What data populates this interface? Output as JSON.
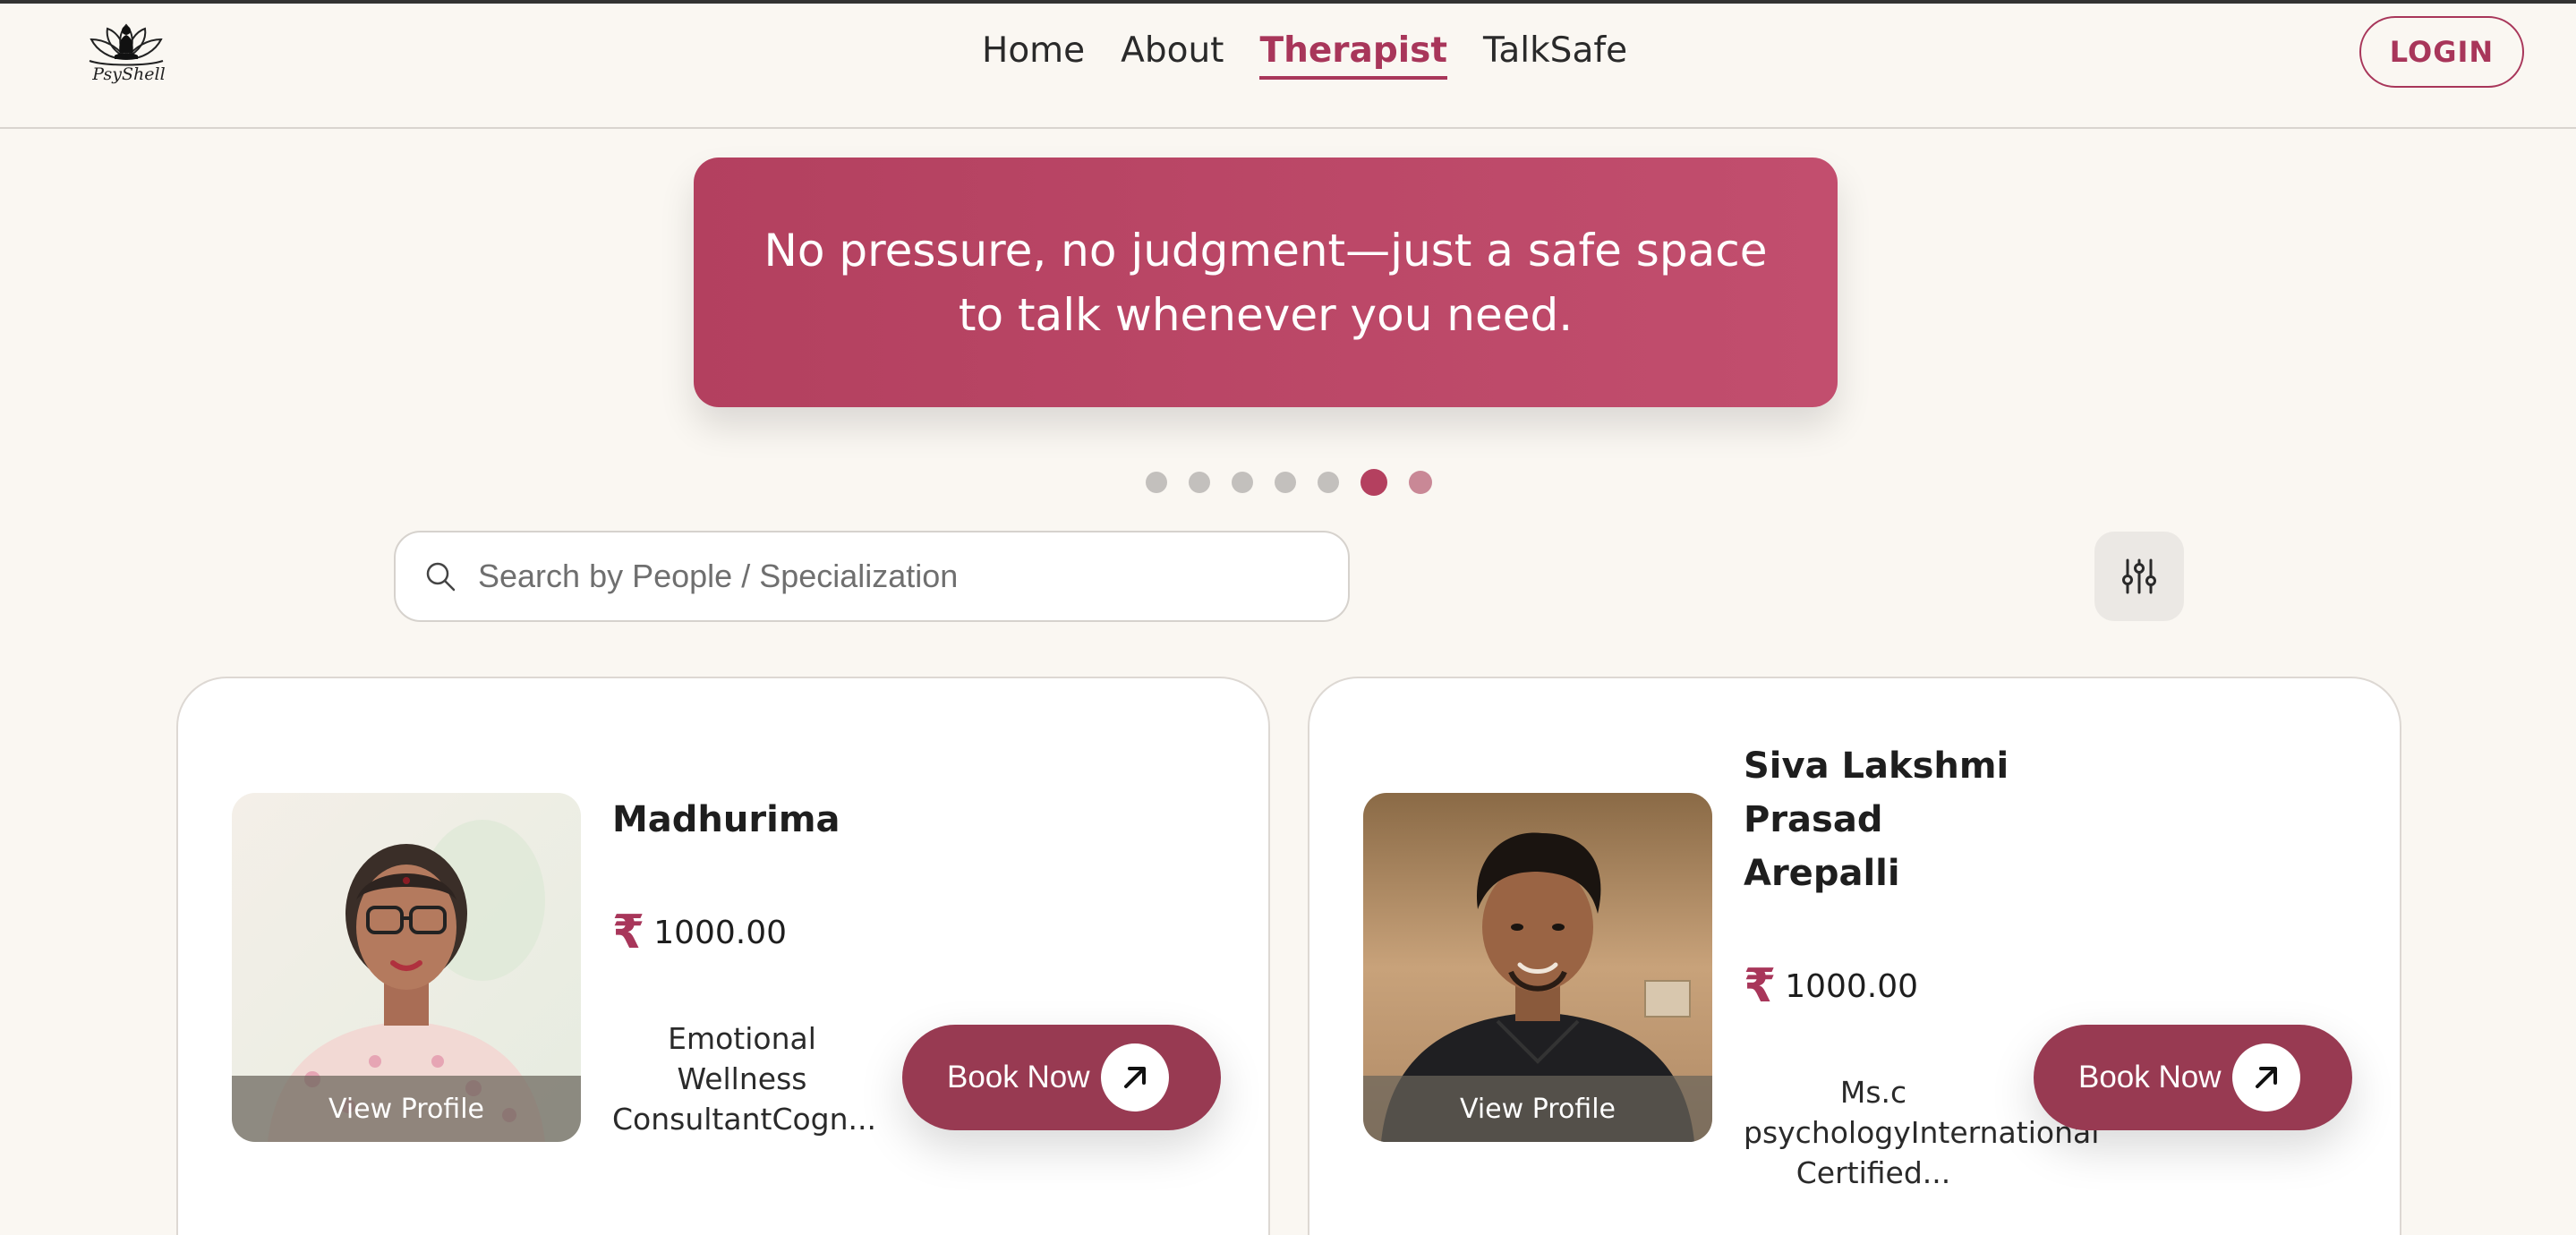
{
  "header": {
    "logo_text": "PsyShell",
    "nav": [
      "Home",
      "About",
      "Therapist",
      "TalkSafe"
    ],
    "active_nav": "Therapist",
    "login_label": "LOGIN"
  },
  "banner": {
    "text": "No pressure, no judgment—just a safe space to talk whenever you need.",
    "slide_count": 7,
    "active_slide": 6
  },
  "search": {
    "placeholder": "Search by People / Specialization",
    "value": ""
  },
  "therapists": [
    {
      "name": "Madhurima",
      "currency": "₹",
      "price": "1000.00",
      "description": "Emotional Wellness ConsultantCogn...",
      "view_profile_label": "View Profile",
      "book_label": "Book Now"
    },
    {
      "name": "Siva Lakshmi Prasad Arepalli",
      "currency": "₹",
      "price": "1000.00",
      "description": "Ms.c psychologyInternational Certified...",
      "view_profile_label": "View Profile",
      "book_label": "Book Now"
    }
  ],
  "colors": {
    "accent": "#a8365a",
    "banner": "#b3405f",
    "book_button": "#983a52",
    "background": "#faf7f2"
  }
}
